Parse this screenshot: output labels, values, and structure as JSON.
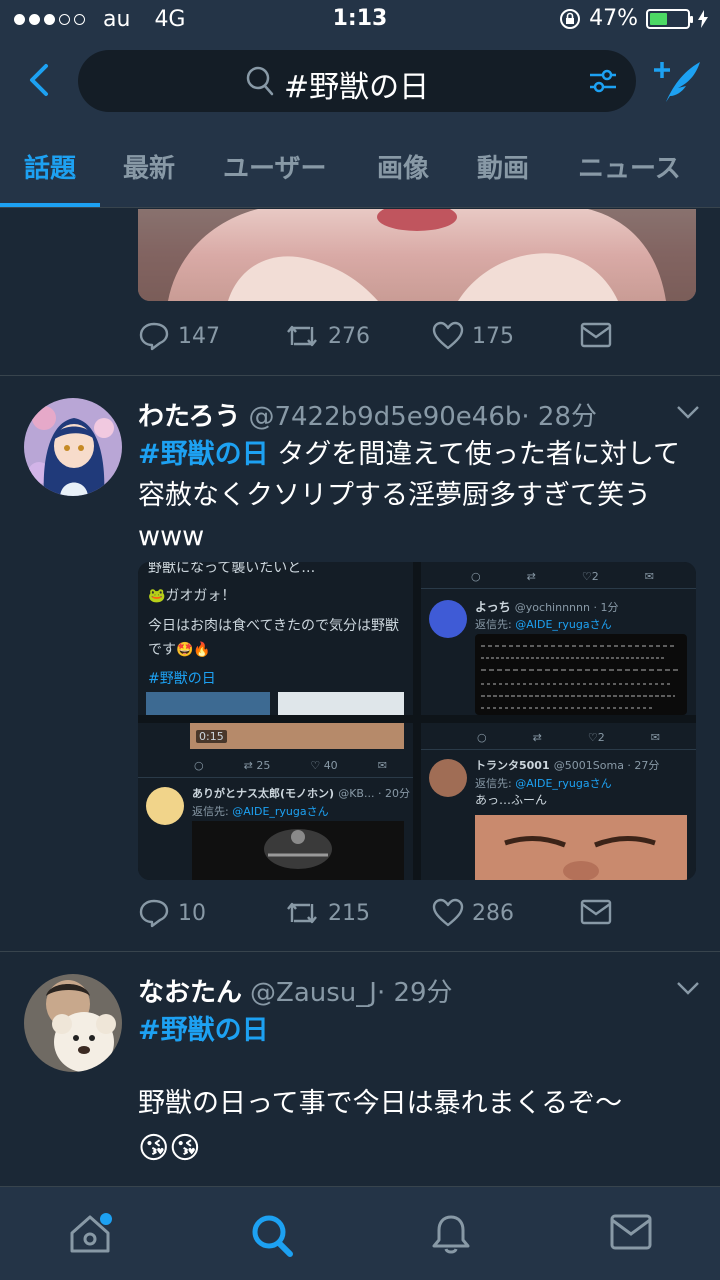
{
  "status": {
    "carrier": "au",
    "network": "4G",
    "time": "1:13",
    "battery": "47%",
    "battery_level": 0.47
  },
  "header": {
    "search_query": "#野獣の日"
  },
  "tabs": [
    "話題",
    "最新",
    "ユーザー",
    "画像",
    "動画",
    "ニュース"
  ],
  "tweet0": {
    "replies": "147",
    "retweets": "276",
    "likes": "175"
  },
  "tweet1": {
    "name": "わたろう",
    "handle": "@7422b9d5e90e46b",
    "time": "· 28分",
    "hashtag": "#野獣の日",
    "text": " タグを間違えて使った者に対して容赦なくクソリプする淫夢厨多すぎて笑うwww",
    "media": {
      "cell1_line1": "野獣になって襲いたいと…",
      "cell1_line2": "🐸ガオガォ！",
      "cell1_line3": "今日はお肉は食べてきたので気分は野獣です🤩🔥",
      "cell1_tag": "#野獣の日",
      "cell2_name": "よっち",
      "cell2_handle": "@yochinnnnn · 1分",
      "cell2_reply": "返信先: ",
      "cell2_reply_to": "@AIDE_ryugaさん",
      "cell2_like": "2",
      "cell3_video_time": "0:15",
      "cell3_rt": "25",
      "cell3_like": "40",
      "cell3_name": "ありがとナス太郎(モノホン)",
      "cell3_handle": "@KB... · 20分",
      "cell3_reply": "返信先: ",
      "cell3_reply_to": "@AIDE_ryugaさん",
      "cell4_name": "トランタ5001",
      "cell4_handle": "@5001Soma · 27分",
      "cell4_reply": "返信先: ",
      "cell4_reply_to": "@AIDE_ryugaさん",
      "cell4_text": "あっ…ふーん",
      "cell4_like": "2"
    },
    "replies": "10",
    "retweets": "215",
    "likes": "286"
  },
  "tweet2": {
    "name": "なおたん",
    "handle": "@Zausu_J",
    "time": "· 29分",
    "hashtag": "#野獣の日",
    "text": "野獣の日って事で今日は暴れまくるぞ〜",
    "emoji": "😘😘"
  },
  "colors": {
    "accent": "#1da1f2",
    "background": "#1b2836",
    "bar": "#243447",
    "muted": "#8899a6"
  },
  "tabbar": [
    "home-icon",
    "search-icon",
    "notifications-icon",
    "messages-icon"
  ]
}
